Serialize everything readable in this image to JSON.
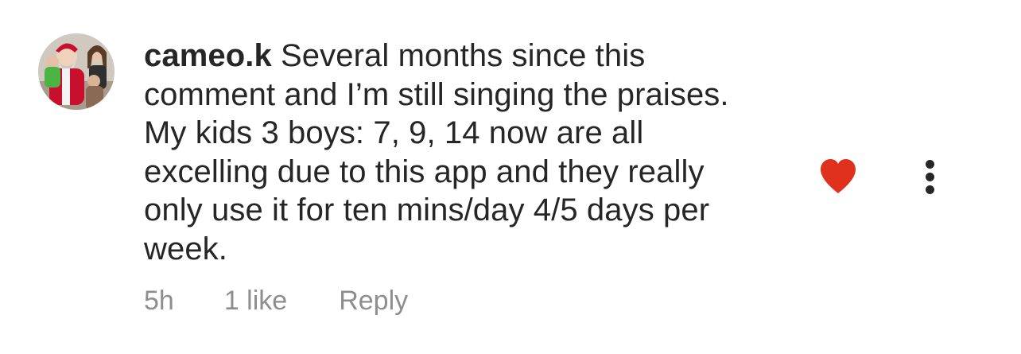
{
  "comment": {
    "username": "cameo.k",
    "text": "Several months since this comment and I’m still singing the praises. My kids 3 boys: 7, 9, 14 now are all excelling due to this app and they really only use it for ten mins/day 4/5 days per week.",
    "lines": [
      "Several months since this",
      "comment and I’m still singing the praises.",
      "My kids 3 boys: 7, 9, 14 now are all",
      "excelling due to this app and they really",
      "only use it for ten mins/day 4/5 days per",
      "week."
    ],
    "time": "5h",
    "likes": "1 like",
    "reply_label": "Reply",
    "liked": true
  },
  "icons": {
    "like": "heart-filled-icon",
    "more": "more-vertical-icon"
  },
  "colors": {
    "heart": "#e0301e",
    "text": "#262626",
    "meta": "#8e8e8e"
  }
}
